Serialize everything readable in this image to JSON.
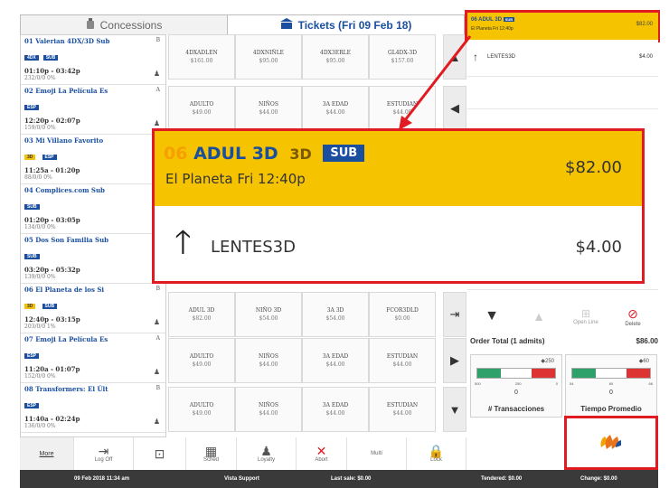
{
  "tabs": {
    "concessions": "Concessions",
    "tickets": "Tickets (Fri 09 Feb 18)"
  },
  "sessions": [
    {
      "num": "01",
      "title": "Valerian 4DX/3D Sub",
      "badges": [
        "4DX",
        "SUB"
      ],
      "rating": "B",
      "time": "01:10p - 03:42p",
      "occupancy": "232/0/0 0%"
    },
    {
      "num": "02",
      "title": "Emoji La Película Es",
      "badges": [
        "ESP"
      ],
      "rating": "A",
      "time": "12:20p - 02:07p",
      "occupancy": "159/0/0 0%"
    },
    {
      "num": "03",
      "title": "Mi Villano Favorito",
      "badges": [
        "3D",
        "ESP"
      ],
      "rating": "",
      "time": "11:25a - 01:20p",
      "occupancy": "88/0/0 0%"
    },
    {
      "num": "04",
      "title": "Complices.com Sub",
      "badges": [
        "SUB"
      ],
      "rating": "",
      "time": "01:20p - 03:05p",
      "occupancy": "134/0/0 0%"
    },
    {
      "num": "05",
      "title": "Dos Son Familia Sub",
      "badges": [
        "SUB"
      ],
      "rating": "",
      "time": "03:20p - 05:32p",
      "occupancy": "139/0/0 0%"
    },
    {
      "num": "06",
      "title": "El Planeta de los Si",
      "badges": [
        "3D",
        "SUB"
      ],
      "rating": "B",
      "time": "12:40p - 03:15p",
      "occupancy": "203/0/0 1%"
    },
    {
      "num": "07",
      "title": "Emoji La Película Es",
      "badges": [
        "ESP"
      ],
      "rating": "A",
      "time": "11:20a - 01:07p",
      "occupancy": "152/0/0 0%"
    },
    {
      "num": "08",
      "title": "Transformers: El Últ",
      "badges": [
        "ESP"
      ],
      "rating": "B",
      "time": "11:40a - 02:24p",
      "occupancy": "136/0/0 0%"
    }
  ],
  "ticket_rows": [
    [
      {
        "name": "4DXADLEN",
        "price": "$161.00"
      },
      {
        "name": "4DXNIÑLE",
        "price": "$95.00"
      },
      {
        "name": "4DX3ERLE",
        "price": "$95.00"
      },
      {
        "name": "GL4DX-3D",
        "price": "$157.00"
      }
    ],
    [
      {
        "name": "ADULTO",
        "price": "$49.00"
      },
      {
        "name": "NIÑOS",
        "price": "$44.00"
      },
      {
        "name": "3A EDAD",
        "price": "$44.00"
      },
      {
        "name": "ESTUDIAN",
        "price": "$44.00"
      }
    ],
    [
      {
        "name": "ADUL 3D",
        "price": "$82.00"
      },
      {
        "name": "NIÑO 3D",
        "price": "$54.00"
      },
      {
        "name": "3A 3D",
        "price": "$54.00"
      },
      {
        "name": "FCOR3DLD",
        "price": "$0.00"
      }
    ],
    [
      {
        "name": "ADULTO",
        "price": "$49.00"
      },
      {
        "name": "NIÑOS",
        "price": "$44.00"
      },
      {
        "name": "3A EDAD",
        "price": "$44.00"
      },
      {
        "name": "ESTUDIAN",
        "price": "$44.00"
      }
    ],
    [
      {
        "name": "ADULTO",
        "price": "$49.00"
      },
      {
        "name": "NIÑOS",
        "price": "$44.00"
      },
      {
        "name": "3A EDAD",
        "price": "$44.00"
      },
      {
        "name": "ESTUDIAN",
        "price": "$44.00"
      }
    ]
  ],
  "order": {
    "line1_num": "06",
    "line1_title": "ADUL 3D",
    "line1_badge": "SUB",
    "line1_session": "El Planeta Fri 12:40p",
    "line1_price": "$82.00",
    "line2_name": "LENTES3D",
    "line2_price": "$4.00",
    "total_label": "Order Total (1 admits)",
    "total_value": "$86.00"
  },
  "controls": {
    "open_line": "Open Line",
    "delete": "Delete"
  },
  "gauges": [
    {
      "label": "# Transacciones",
      "value": "0",
      "target": "250",
      "scale": [
        "500",
        "250",
        "0"
      ],
      "level": 0
    },
    {
      "label": "Tiempo Promedio",
      "value": "0",
      "target": "60",
      "scale": [
        "54",
        "60",
        "66"
      ],
      "level": 0
    }
  ],
  "toolbar": {
    "more": "More",
    "logoff": "Log Off",
    "sched": "Sched",
    "loyalty": "Loyalty",
    "abort": "Abort",
    "multi": "Multi",
    "lock": "Lock"
  },
  "status": {
    "datetime": "09 Feb 2018 11:34 am",
    "support": "Vista Support",
    "last_sale": "Last sale: $0.00",
    "tendered": "Tendered: $0.00",
    "change": "Change: $0.00"
  },
  "colors": {
    "accent_yellow": "#f5c300",
    "brand_blue": "#1a4fa0",
    "highlight_red": "#e01b22"
  }
}
